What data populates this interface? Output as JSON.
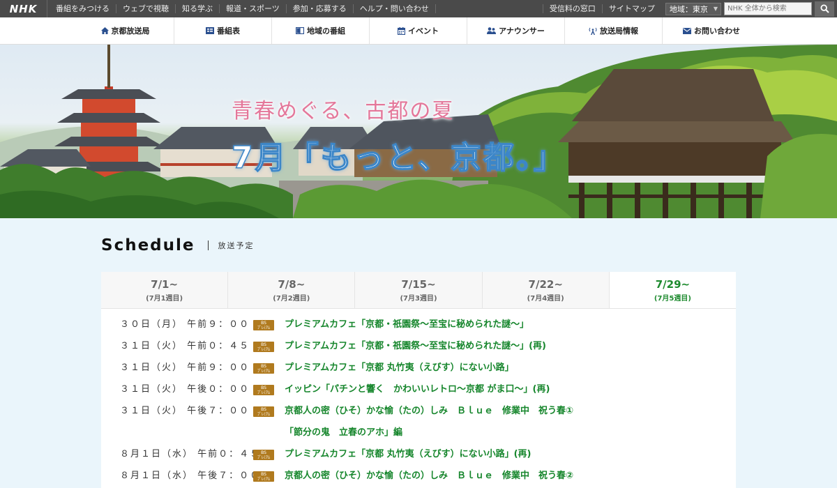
{
  "topbar": {
    "logo": "NHK",
    "links": [
      "番組をみつける",
      "ウェブで視聴",
      "知る学ぶ",
      "報道・スポーツ",
      "参加・応募する",
      "ヘルプ・問い合わせ"
    ],
    "right_links": [
      "受信料の窓口",
      "サイトマップ"
    ],
    "region_label": "地域：東京",
    "search_placeholder": "NHK 全体から検索"
  },
  "nav": {
    "items": [
      {
        "label": "京都放送局",
        "icon": "home-icon"
      },
      {
        "label": "番組表",
        "icon": "tv-guide-icon"
      },
      {
        "label": "地域の番組",
        "icon": "book-icon"
      },
      {
        "label": "イベント",
        "icon": "calendar-icon"
      },
      {
        "label": "アナウンサー",
        "icon": "people-icon"
      },
      {
        "label": "放送局情報",
        "icon": "antenna-icon"
      },
      {
        "label": "お問い合わせ",
        "icon": "mail-icon"
      }
    ]
  },
  "hero": {
    "subtitle": "青春めぐる、古都の夏",
    "title": "7月「もっと、京都。」"
  },
  "schedule": {
    "title": "Schedule",
    "subtitle": "放送予定",
    "weeks": [
      {
        "date": "7/1~",
        "note": "(7月1週目)"
      },
      {
        "date": "7/8~",
        "note": "(7月2週目)"
      },
      {
        "date": "7/15~",
        "note": "(7月3週目)"
      },
      {
        "date": "7/22~",
        "note": "(7月4週目)"
      },
      {
        "date": "7/29~",
        "note": "(7月5週目)"
      }
    ],
    "active_week": 4,
    "badge_text": "BSプレミアム",
    "programs": [
      {
        "when": "３０日（月） 午前９：００",
        "title": "プレミアムカフェ「京都・祇園祭～至宝に秘められた謎～」",
        "title2": ""
      },
      {
        "when": "３１日（火） 午前０：４５",
        "title": "プレミアムカフェ「京都・祇園祭～至宝に秘められた謎～」(再)",
        "title2": ""
      },
      {
        "when": "３１日（火） 午前９：００",
        "title": "プレミアムカフェ「京都 丸竹夷（えびす）にない小路」",
        "title2": ""
      },
      {
        "when": "３１日（火） 午後０：００",
        "title": "イッピン「パチンと響く　かわいいレトロ～京都 がま口～」(再)",
        "title2": ""
      },
      {
        "when": "３１日（火） 午後７：００",
        "title": "京都人の密（ひそ）かな愉（たの）しみ　Ｂｌｕｅ　修業中　祝う春①",
        "title2": "「節分の鬼　立春のアホ」編"
      },
      {
        "when": "８月１日（水） 午前０：４５",
        "title": "プレミアムカフェ「京都 丸竹夷（えびす）にない小路」(再)",
        "title2": ""
      },
      {
        "when": "８月１日（水） 午後７：００",
        "title": "京都人の密（ひそ）かな愉（たの）しみ　Ｂｌｕｅ　修業中　祝う春②",
        "title2": ""
      }
    ]
  },
  "colors": {
    "accent_green": "#16862c",
    "badge_brown": "#b07a1e",
    "nav_icon_blue": "#2a4f8f",
    "hero_pink": "#e4779a",
    "hero_title_outline": "#3c86c8"
  }
}
